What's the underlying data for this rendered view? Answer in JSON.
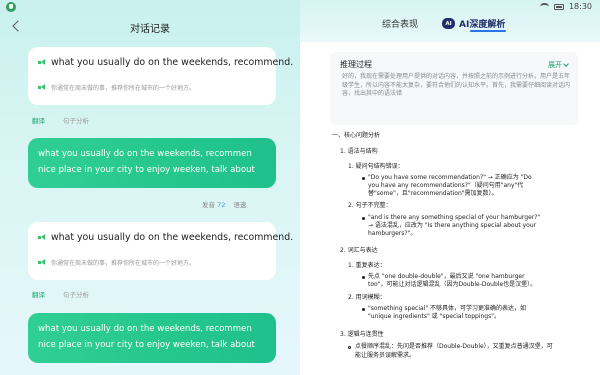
{
  "status_bar": {
    "time": "18:30"
  },
  "left": {
    "title": "对话记录",
    "bubbles": [
      {
        "en": "what you usually do on the weekends, recommend.",
        "zh": "你通常在周末做的事，推荐你所在城市的一个好地方。",
        "translate": "翻译",
        "analyze": "句子分析"
      },
      {
        "en": "what you usually do on the weekends, recommend.",
        "zh": "你通常在周末做的事，推荐你所在城市的一个好地方。",
        "translate": "翻译",
        "analyze": "句子分析"
      }
    ],
    "user_messages": [
      {
        "text": "what you usually do on the weekends, recommen nice place in your city to enjoy weeken, talk about",
        "pron_label": "发音",
        "score": "72",
        "speed_label": "语速"
      },
      {
        "text": "what you usually do on the weekends, recommen nice place in your city to enjoy weeken, talk about"
      }
    ]
  },
  "right": {
    "tabs": {
      "overall": "综合表现",
      "ai_badge": "AI",
      "ai_label": "AI深度解析"
    },
    "reasoning": {
      "title": "推理过程",
      "expand": "展开",
      "text": "好的，我现在需要处理用户提供的对话内容，并按照之前的示例进行分析。用户是五年级学生，所以内容不能太复杂，要符合他们的认知水平。首先，我需要仔细阅读对话内容，找出其中的语法错"
    },
    "analysis": {
      "h1": "一、核心问题分析",
      "s1": "1. 语法与结构",
      "s1_1": "1. 疑问句结构错误：",
      "b1": "\"Do you have some recommendation?\" → 正确应为 \"Do",
      "b1c": "you have any recommendations?\"（疑问句用\"any\"代",
      "b1d": "替\"some\"，且\"recommendation\"需加复数）。",
      "s1_2": "2. 句子不完整：",
      "b2": "\"and is there any something special of your hamburger?\"",
      "b2c": "→ 语法混乱，应改为 \"Is there anything special about your",
      "b2d": "hamburgers?\"。",
      "s2": "2. 词汇与表达",
      "s2_1": "1. 重复表达：",
      "b3": "先点 \"one double-double\"，最后又说 \"one hamburger",
      "b3c": "too\"，可能让对话逻辑混乱（因为Double-Double也是汉堡）。",
      "s2_2": "2. 用词模糊：",
      "b4": "\"something special\" 不够具体，可学习更准确的表达，如",
      "b4c": "\"unique ingredients\" 或 \"special toppings\"。",
      "s3": "3. 逻辑与连贯性",
      "b5": "点餐顺序混乱：先问是否推荐（Double-Double），又重复点普通汉堡，可",
      "b5c": "能让服务员误解需求。"
    }
  }
}
